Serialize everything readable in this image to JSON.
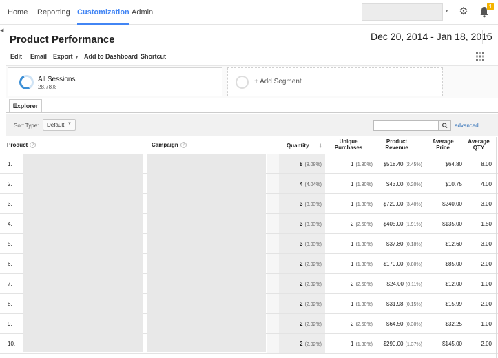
{
  "nav": {
    "tabs": [
      {
        "label": "Home"
      },
      {
        "label": "Reporting"
      },
      {
        "label": "Customization"
      },
      {
        "label": "Admin"
      }
    ],
    "notification_count": "1"
  },
  "report": {
    "title": "Product Performance",
    "date_range": "Dec 20, 2014 - Jan 18, 2015"
  },
  "toolbar": {
    "edit": "Edit",
    "email": "Email",
    "export": "Export",
    "add_to_dashboard": "Add to Dashboard",
    "shortcut": "Shortcut"
  },
  "segments": {
    "active_name": "All Sessions",
    "active_pct": "28.78%",
    "add_label": "+ Add Segment"
  },
  "explorer_tab": "Explorer",
  "sort": {
    "label": "Sort Type:",
    "value": "Default",
    "advanced": "advanced"
  },
  "table": {
    "headers": {
      "product": "Product",
      "campaign": "Campaign",
      "quantity": "Quantity",
      "unique_purchases": "Unique Purchases",
      "product_revenue": "Product Revenue",
      "average_price": "Average Price",
      "average_qty": "Average QTY"
    },
    "rows": [
      {
        "idx": "1.",
        "qty": "8",
        "qty_pct": "(8.08%)",
        "up": "1",
        "up_pct": "(1.30%)",
        "rev": "$518.40",
        "rev_pct": "(2.45%)",
        "avg_price": "$64.80",
        "avg_qty": "8.00"
      },
      {
        "idx": "2.",
        "qty": "4",
        "qty_pct": "(4.04%)",
        "up": "1",
        "up_pct": "(1.30%)",
        "rev": "$43.00",
        "rev_pct": "(0.20%)",
        "avg_price": "$10.75",
        "avg_qty": "4.00"
      },
      {
        "idx": "3.",
        "qty": "3",
        "qty_pct": "(3.03%)",
        "up": "1",
        "up_pct": "(1.30%)",
        "rev": "$720.00",
        "rev_pct": "(3.40%)",
        "avg_price": "$240.00",
        "avg_qty": "3.00"
      },
      {
        "idx": "4.",
        "qty": "3",
        "qty_pct": "(3.03%)",
        "up": "2",
        "up_pct": "(2.60%)",
        "rev": "$405.00",
        "rev_pct": "(1.91%)",
        "avg_price": "$135.00",
        "avg_qty": "1.50"
      },
      {
        "idx": "5.",
        "qty": "3",
        "qty_pct": "(3.03%)",
        "up": "1",
        "up_pct": "(1.30%)",
        "rev": "$37.80",
        "rev_pct": "(0.18%)",
        "avg_price": "$12.60",
        "avg_qty": "3.00"
      },
      {
        "idx": "6.",
        "qty": "2",
        "qty_pct": "(2.02%)",
        "up": "1",
        "up_pct": "(1.30%)",
        "rev": "$170.00",
        "rev_pct": "(0.80%)",
        "avg_price": "$85.00",
        "avg_qty": "2.00"
      },
      {
        "idx": "7.",
        "qty": "2",
        "qty_pct": "(2.02%)",
        "up": "2",
        "up_pct": "(2.60%)",
        "rev": "$24.00",
        "rev_pct": "(0.11%)",
        "avg_price": "$12.00",
        "avg_qty": "1.00"
      },
      {
        "idx": "8.",
        "qty": "2",
        "qty_pct": "(2.02%)",
        "up": "1",
        "up_pct": "(1.30%)",
        "rev": "$31.98",
        "rev_pct": "(0.15%)",
        "avg_price": "$15.99",
        "avg_qty": "2.00"
      },
      {
        "idx": "9.",
        "qty": "2",
        "qty_pct": "(2.02%)",
        "up": "2",
        "up_pct": "(2.60%)",
        "rev": "$64.50",
        "rev_pct": "(0.30%)",
        "avg_price": "$32.25",
        "avg_qty": "1.00"
      },
      {
        "idx": "10.",
        "qty": "2",
        "qty_pct": "(2.02%)",
        "up": "1",
        "up_pct": "(1.30%)",
        "rev": "$290.00",
        "rev_pct": "(1.37%)",
        "avg_price": "$145.00",
        "avg_qty": "2.00"
      }
    ]
  }
}
